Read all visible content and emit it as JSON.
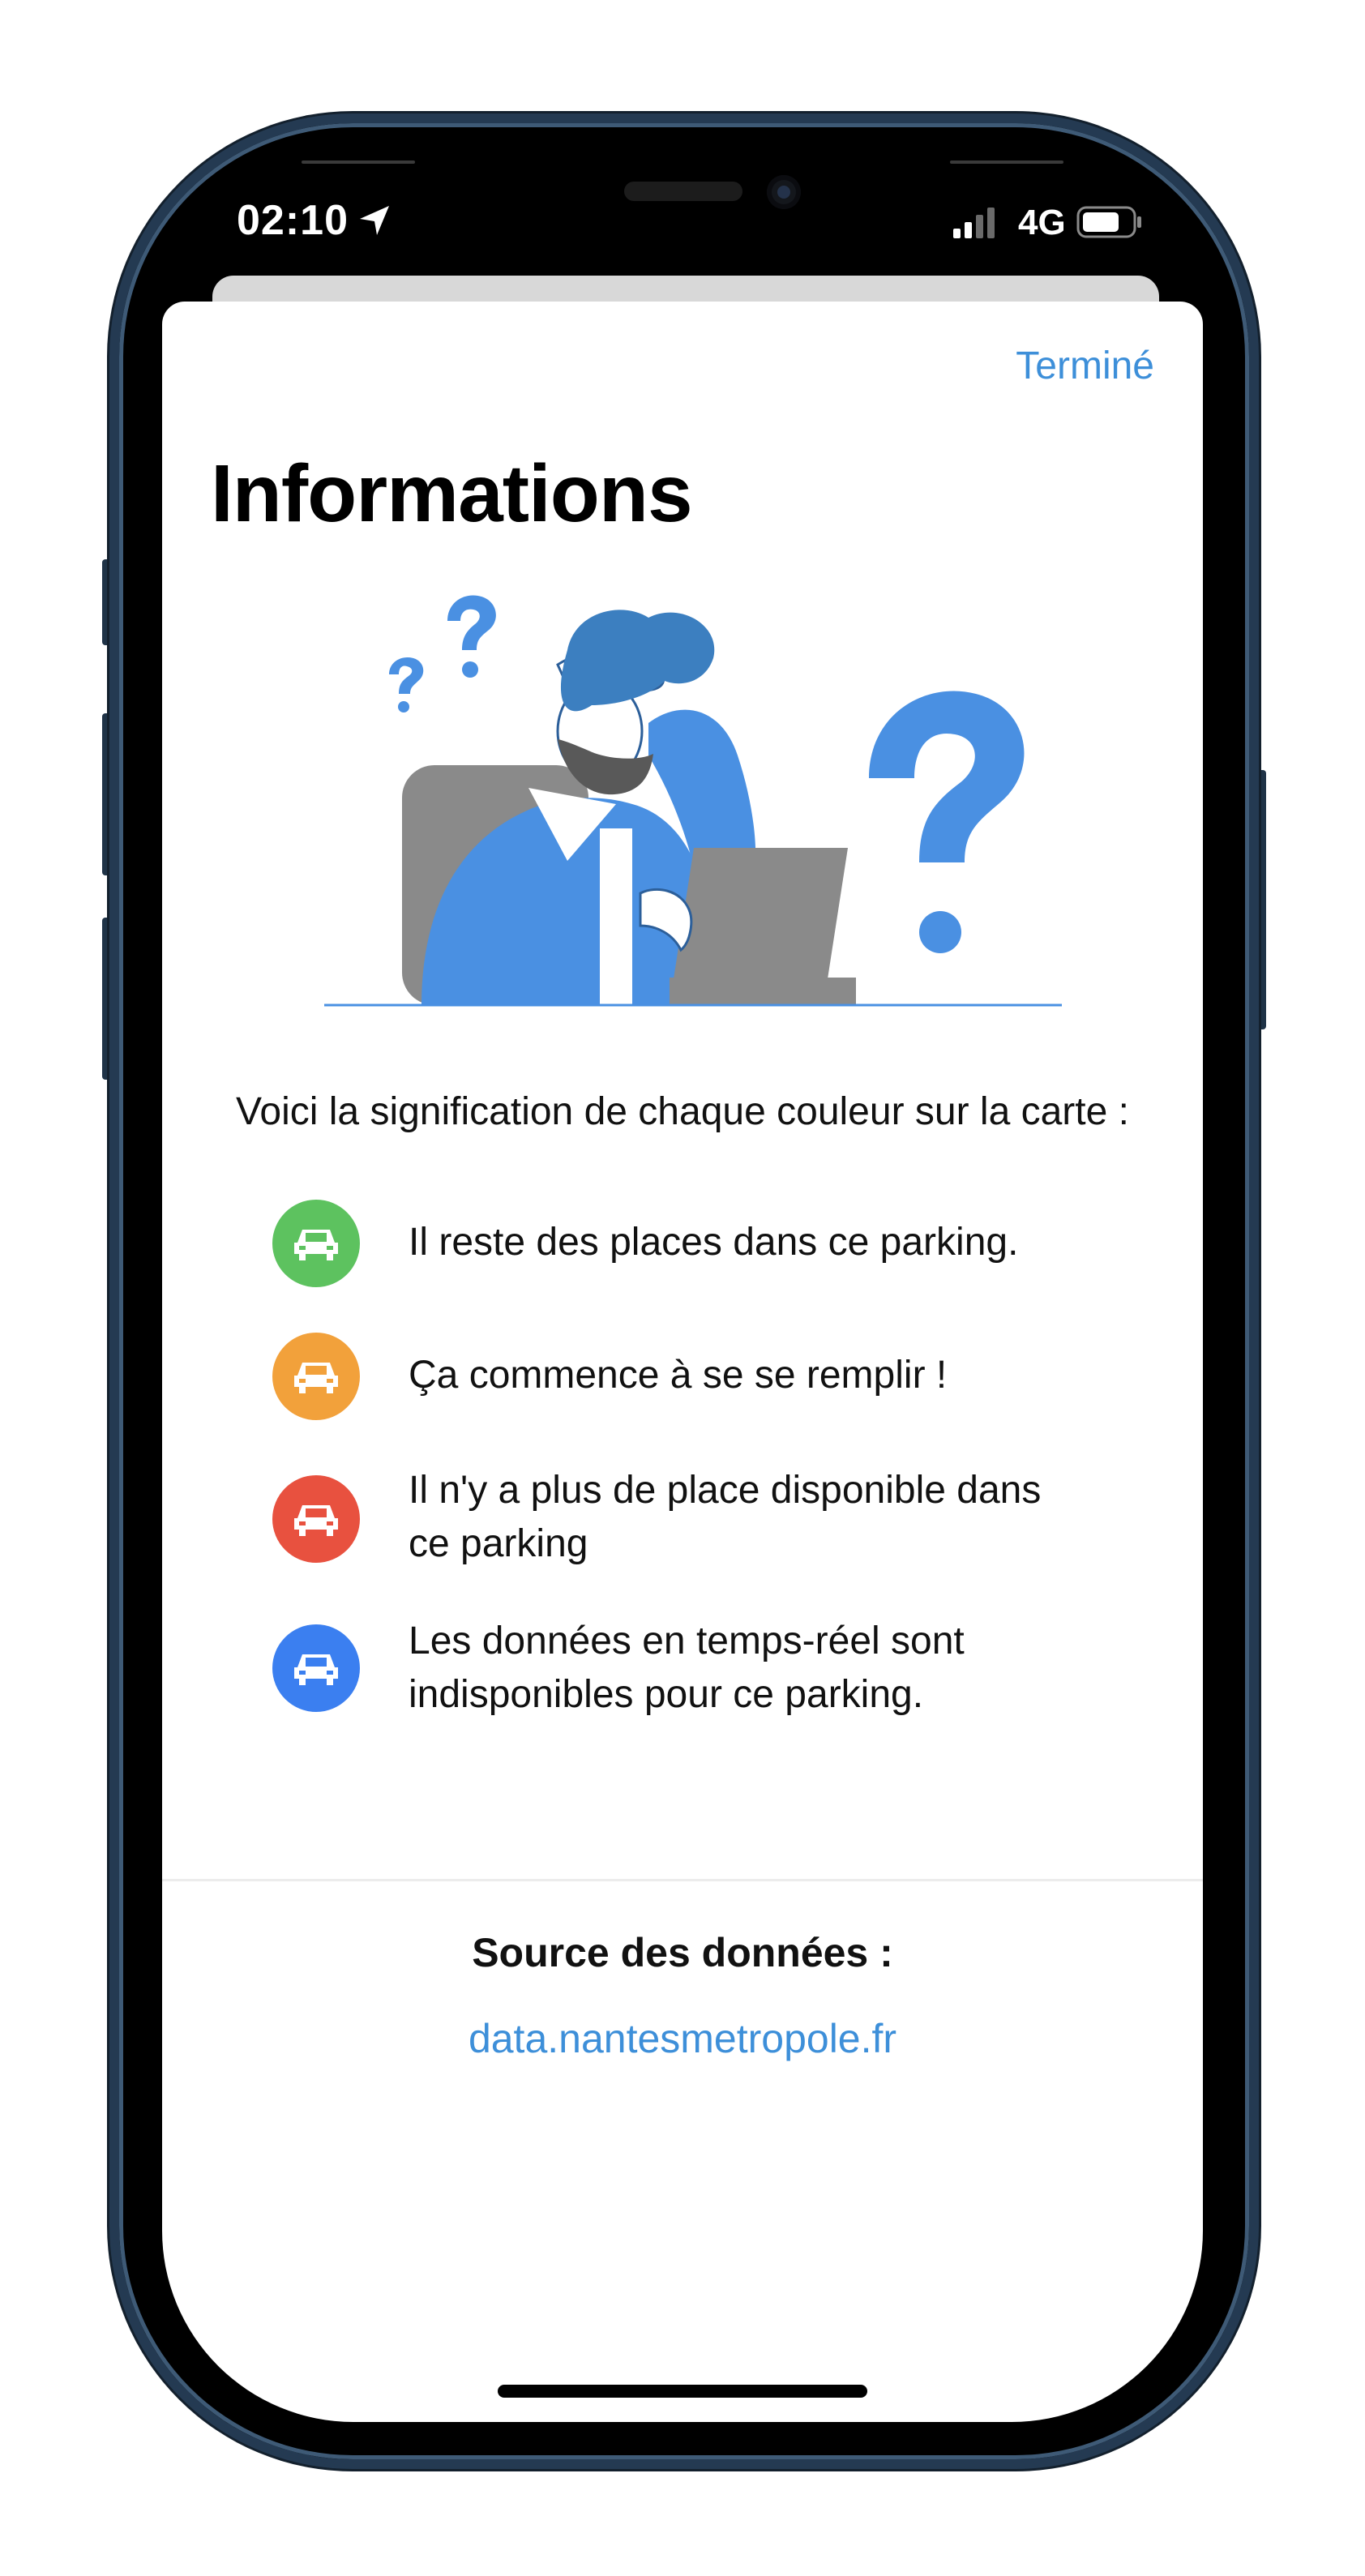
{
  "status_bar": {
    "time": "02:10",
    "network": "4G"
  },
  "sheet": {
    "done_label": "Terminé",
    "title": "Informations",
    "intro": "Voici la signification de chaque couleur sur la carte :"
  },
  "legend": [
    {
      "color": "#5dc25f",
      "icon": "car-icon",
      "line1": "Il reste des places dans ce parking.",
      "line2": ""
    },
    {
      "color": "#f2a13b",
      "icon": "car-icon",
      "line1": "Ça commence à se se remplir !",
      "line2": ""
    },
    {
      "color": "#e8513f",
      "icon": "car-icon",
      "line1": "Il n'y a plus de place disponible dans",
      "line2": "ce parking"
    },
    {
      "color": "#3b7ff0",
      "icon": "car-icon",
      "line1": "Les données en temps-réel sont",
      "line2": "indisponibles pour ce parking."
    }
  ],
  "source": {
    "label": "Source des données :",
    "link": "data.nantesmetropole.fr"
  },
  "colors": {
    "accent": "#3d8fd9",
    "illustration_blue": "#4a90e2",
    "illustration_gray": "#8a8a8a"
  }
}
